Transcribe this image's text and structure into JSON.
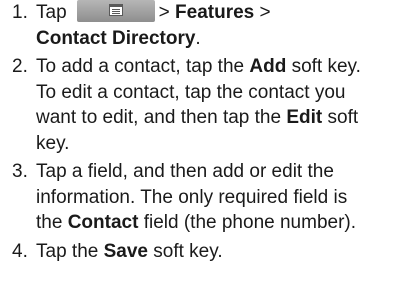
{
  "steps": [
    {
      "num": "1.",
      "t1": "Tap",
      "button_icon": "menu-icon",
      "t2": "> ",
      "b1": "Features",
      "t3": " >",
      "b2": "Contact Directory",
      "t4": "."
    },
    {
      "num": "2.",
      "t1": "To add a contact, tap the ",
      "b1": "Add",
      "t2": " soft key.",
      "t3": "To edit a contact, tap the contact you",
      "t4": "want to edit, and then tap the ",
      "b2": "Edit",
      "t5": " soft",
      "t6": "key."
    },
    {
      "num": "3.",
      "t1": "Tap a field, and then add or edit the",
      "t2": "information. The only required field is",
      "t3": "the ",
      "b1": "Contact",
      "t4": " field (the phone number)."
    },
    {
      "num": "4.",
      "t1": "Tap the ",
      "b1": "Save",
      "t2": " soft key."
    }
  ],
  "colors": {
    "text": "#1a1a1a",
    "button": "#a0a0a0"
  }
}
